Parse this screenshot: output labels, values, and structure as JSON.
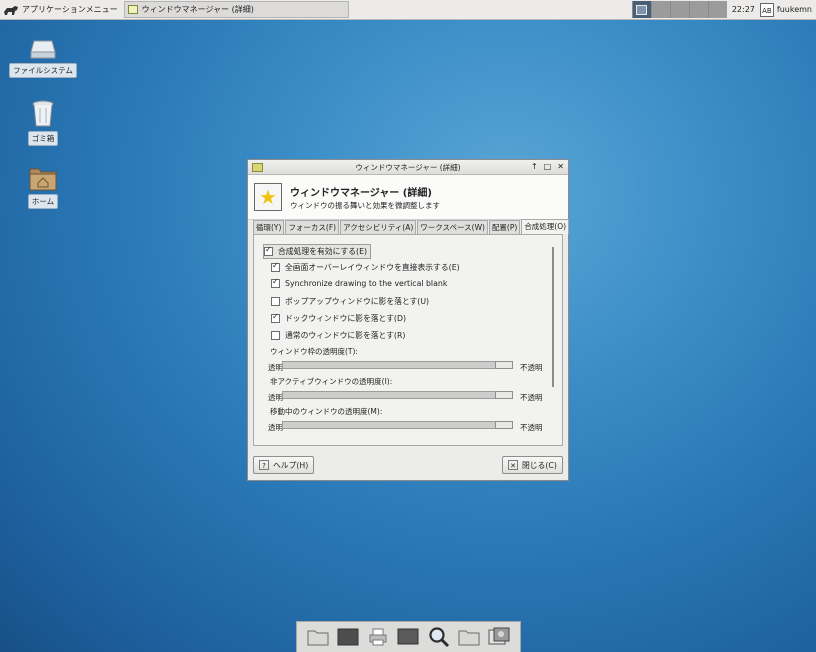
{
  "top_panel": {
    "apps_menu_label": "アプリケーションメニュー",
    "task_label": "ウィンドウマネージャー (詳細)",
    "clock": "22:27",
    "user_icon_text": "AB",
    "username": "fuukemn"
  },
  "desktop": {
    "icons": [
      {
        "label": "ファイルシステム",
        "icon": "drive-icon"
      },
      {
        "label": "ゴミ箱",
        "icon": "trash-icon"
      },
      {
        "label": "ホーム",
        "icon": "home-folder-icon"
      }
    ]
  },
  "dialog": {
    "title": "ウィンドウマネージャー (詳細)",
    "controls": [
      "↑",
      "□",
      "✕"
    ],
    "heading": "ウィンドウマネージャー (詳細)",
    "subheading": "ウィンドウの振る舞いと効果を微調整します",
    "tabs": [
      "循環(Y)",
      "フォーカス(F)",
      "アクセシビリティ(A)",
      "ワークスペース(W)",
      "配置(P)",
      "合成処理(O)"
    ],
    "active_tab_index": 5,
    "master_checkbox": {
      "label": "合成処理を有効にする(E)",
      "checked": true
    },
    "options": [
      {
        "label": "全画面オーバーレイウィンドウを直接表示する(E)",
        "checked": true
      },
      {
        "label": "Synchronize drawing to the vertical blank",
        "checked": true
      },
      {
        "label": "ポップアップウィンドウに影を落とす(U)",
        "checked": false
      },
      {
        "label": "ドックウィンドウに影を落とす(D)",
        "checked": true
      },
      {
        "label": "通常のウィンドウに影を落とす(R)",
        "checked": false
      }
    ],
    "sliders": [
      {
        "label": "ウィンドウ枠の透明度(T):",
        "min_label": "透明",
        "max_label": "不透明",
        "value": 1.0
      },
      {
        "label": "非アクティブウィンドウの透明度(I):",
        "min_label": "透明",
        "max_label": "不透明",
        "value": 1.0
      },
      {
        "label": "移動中のウィンドウの透明度(M):",
        "min_label": "透明",
        "max_label": "不透明",
        "value": 1.0
      }
    ],
    "help_button": "ヘルプ(H)",
    "close_button": "閉じる(C)"
  },
  "dock": {
    "items": [
      "folder-icon",
      "terminal-icon",
      "printer-icon",
      "screen-icon",
      "search-icon",
      "folder-icon",
      "image-viewer-icon"
    ]
  }
}
